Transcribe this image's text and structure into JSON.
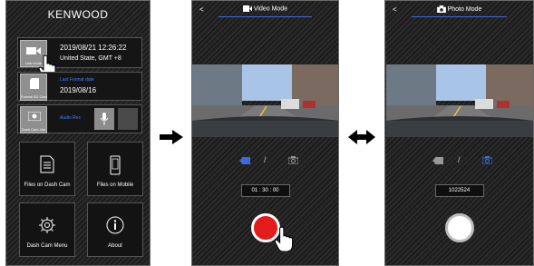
{
  "screen1": {
    "brand": "KENWOOD",
    "datetime": {
      "tile_label": "Link mode",
      "date_time": "2019/08/21  12:26:22",
      "region": "United State, GMT +8"
    },
    "sdcard": {
      "tile_label": "Format SD Card",
      "caption": "Last Format date",
      "date": "2019/08/16"
    },
    "audio": {
      "tile_label": "Dash Cam Info",
      "caption": "Audio Rec"
    },
    "menu": [
      {
        "label": "Files on Dash Cam",
        "icon": "document-icon"
      },
      {
        "label": "Files on Mobile",
        "icon": "mobile-phone-icon"
      },
      {
        "label": "Dash Cam Menu",
        "icon": "gear-icon"
      },
      {
        "label": "About",
        "icon": "info-icon"
      }
    ]
  },
  "screen2": {
    "back": "<",
    "title": "Video Mode",
    "counter": "01 : 30 : 00",
    "separator": "/"
  },
  "screen3": {
    "back": "<",
    "title": "Photo Mode",
    "counter": "1022524",
    "separator": "/"
  },
  "colors": {
    "accent": "#3a6bd9",
    "record": "#e21b1b",
    "background": "#222222"
  }
}
